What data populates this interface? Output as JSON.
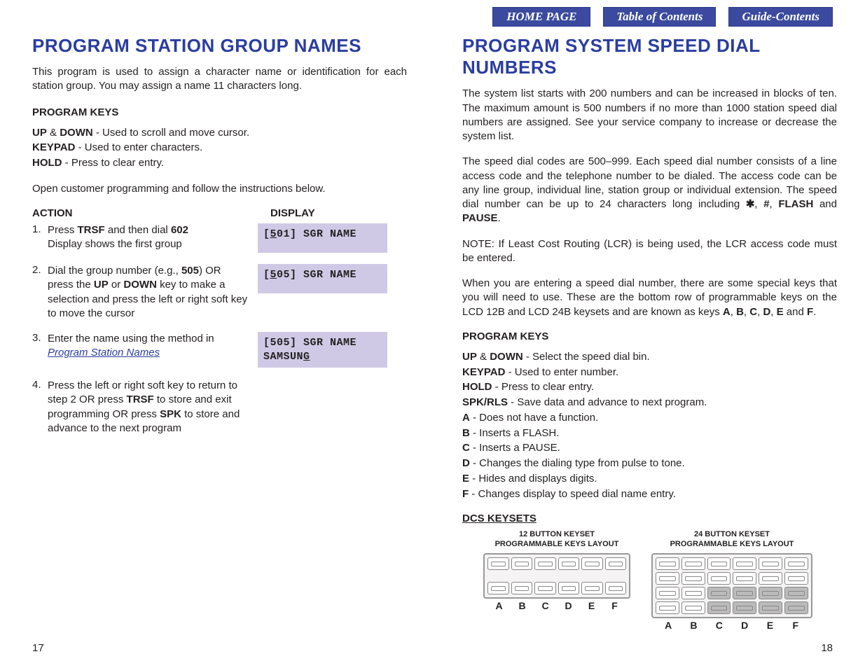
{
  "nav": {
    "home": "HOME PAGE",
    "toc": "Table of Contents",
    "guide": "Guide-Contents"
  },
  "left": {
    "title": "PROGRAM STATION GROUP NAMES",
    "intro": "This program is used to assign a character name or identification for each station group. You may assign a name 11 characters long.",
    "prog_keys_head": "PROGRAM KEYS",
    "keys": {
      "updown_label": "UP",
      "amp": " & ",
      "down_label": "DOWN",
      "updown_desc": " - Used to scroll and move cursor.",
      "keypad_label": "KEYPAD",
      "keypad_desc": " - Used to enter characters.",
      "hold_label": "HOLD",
      "hold_desc": " - Press to clear entry."
    },
    "open_line": "Open customer programming and follow the instructions below.",
    "col_action": "ACTION",
    "col_display": "DISPLAY",
    "steps": [
      {
        "pre": "Press ",
        "b1": "TRSF",
        "mid": " and then dial ",
        "b2": "602",
        "line2": "Display shows the first group",
        "disp_pre": "[",
        "disp_u": "5",
        "disp_post": "01] SGR NAME"
      },
      {
        "pre": "Dial the group number (e.g., ",
        "b1": "505",
        "mid": ") OR press the ",
        "b2": "UP",
        "mid2": " or ",
        "b3": "DOWN",
        "post": " key to make a selection and press the left or right soft key to move the cursor",
        "disp_pre": "[",
        "disp_u": "5",
        "disp_post": "05] SGR NAME"
      },
      {
        "pre": "Enter the name using the method in ",
        "link": "Program Station Names",
        "disp_l1": "[505] SGR NAME",
        "disp_l2_pre": "SAMSUN",
        "disp_l2_u": "G"
      },
      {
        "pre": "Press the left or right soft key to return to step 2 OR press ",
        "b1": "TRSF",
        "mid": " to store and exit programming OR press ",
        "b2": "SPK",
        "post": " to store and advance to the next program"
      }
    ],
    "page_num": "17"
  },
  "right": {
    "title": "PROGRAM SYSTEM SPEED DIAL NUMBERS",
    "p1": "The system list starts with 200 numbers and can be increased in blocks of ten. The maximum amount is 500 numbers if no more than 1000 station speed dial numbers are assigned. See your service company to increase or decrease the system list.",
    "p2_pre": "The speed dial codes are 500–999. Each speed dial number consists of a line access code and the telephone number to be dialed. The access code can be any line group, individual line, station group or individual extension. The speed dial number can be up to 24 characters long including ",
    "p2_sym1": "✱",
    "p2_c": ", ",
    "p2_sym2": "#",
    "p2_c2": ", ",
    "p2_b1": "FLASH",
    "p2_and": " and ",
    "p2_b2": "PAUSE",
    "p2_end": ".",
    "note": "NOTE: If Least Cost Routing (LCR) is being used, the LCR access code must be entered.",
    "p3_pre": "When you are entering a speed dial number, there are some special keys that you will need to use. These are the bottom row of programmable keys on the LCD 12B and LCD 24B keysets and are known as keys ",
    "p3_a": "A",
    "p3_c1": ", ",
    "p3_b": "B",
    "p3_c2": ", ",
    "p3_c": "C",
    "p3_c3": ", ",
    "p3_d": "D",
    "p3_c4": ", ",
    "p3_e": "E",
    "p3_and": " and ",
    "p3_f": "F",
    "p3_end": ".",
    "prog_keys_head": "PROGRAM KEYS",
    "keys": [
      {
        "b": "UP",
        "amp": " & ",
        "b2": "DOWN",
        "d": " - Select the speed dial bin."
      },
      {
        "b": "KEYPAD",
        "d": " - Used to enter number."
      },
      {
        "b": "HOLD",
        "d": " - Press to clear entry."
      },
      {
        "b": "SPK/RLS",
        "d": " - Save data and advance to next program."
      },
      {
        "b": "A",
        "d": " - Does not have a function."
      },
      {
        "b": "B",
        "d": " - Inserts a FLASH."
      },
      {
        "b": "C",
        "d": " - Inserts a PAUSE."
      },
      {
        "b": "D",
        "d": " - Changes the dialing type from pulse to tone."
      },
      {
        "b": "E",
        "d": " - Hides and displays digits."
      },
      {
        "b": "F",
        "d": " - Changes display to speed dial name entry."
      }
    ],
    "dcs_head": "DCS KEYSETS",
    "k12_title_l1": "12 BUTTON KEYSET",
    "k12_title_l2": "PROGRAMMABLE KEYS LAYOUT",
    "k24_title_l1": "24 BUTTON KEYSET",
    "k24_title_l2": "PROGRAMMABLE KEYS LAYOUT",
    "labels": [
      "A",
      "B",
      "C",
      "D",
      "E",
      "F"
    ],
    "page_num": "18"
  }
}
